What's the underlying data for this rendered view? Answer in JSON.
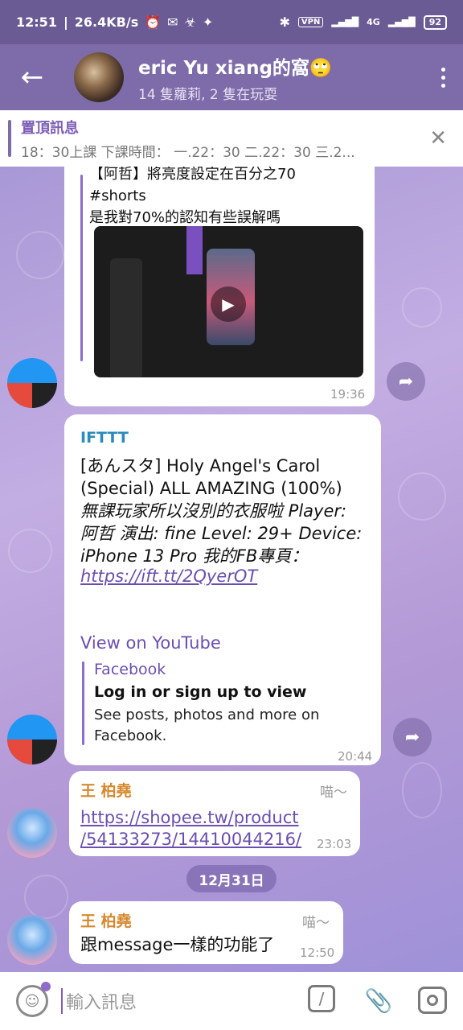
{
  "status": {
    "time": "12:51",
    "speed": "26.4KB/s",
    "vpn": "VPN",
    "net": "4G",
    "battery": "92"
  },
  "header": {
    "title": "eric Yu xiang的窩🙄",
    "subtitle": "14 隻蘿莉, 2 隻在玩耍"
  },
  "pinned": {
    "label": "置頂訊息",
    "text": "18：30上課 下課時間： 一.22：30 二.22：30 三.2..."
  },
  "messages": {
    "m1": {
      "top_line": "【阿哲】將亮度設定在百分之70",
      "line2": "#shorts",
      "line3": "是我對70%的認知有些誤解嗎",
      "time": "19:36"
    },
    "m2": {
      "sender": "IFTTT",
      "line1": "[あんスタ] Holy Angel's Carol",
      "line2": "(Special) ALL AMAZING (100%)",
      "ital1": "無課玩家所以沒別的衣服啦 Player:",
      "ital2": "阿哲 演出: fine Level: 29+ Device:",
      "ital3": "iPhone 13 Pro 我的FB專頁：",
      "link": "https://ift.tt/2QyerOT",
      "view_label": "View on YouTube",
      "preview_site": "Facebook",
      "preview_title": "Log in or sign up to view",
      "preview_desc1": "See posts, photos and more on",
      "preview_desc2": "Facebook.",
      "time": "20:44"
    },
    "m3": {
      "sender": "王 柏堯",
      "role": "喵～",
      "link1": "https://shopee.tw/product",
      "link2": "/54133273/14410044216/",
      "time": "23:03"
    },
    "date_pill": "12月31日",
    "m4": {
      "sender": "王 柏堯",
      "role": "喵～",
      "text": "跟message一樣的功能了",
      "time": "12:50"
    }
  },
  "composer": {
    "placeholder": "輸入訊息",
    "cmd_label": "/"
  }
}
